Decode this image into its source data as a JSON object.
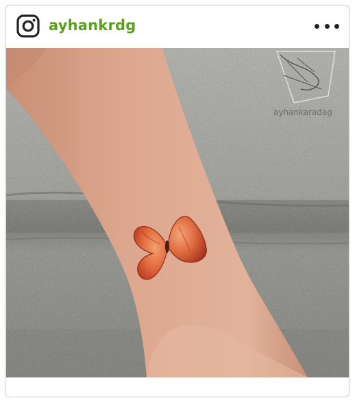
{
  "post": {
    "username": "ayhankrdg",
    "more_options_label": "More options",
    "watermark_text": "ayhankaradag",
    "image_alt": "Red butterfly tattoo on wrist against stone wall"
  },
  "colors": {
    "username": "#5aa01f",
    "card_border": "#c8c8c8",
    "butterfly": "#d8502b"
  },
  "icons": {
    "logo": "instagram-icon",
    "menu": "more-horizontal-icon"
  }
}
